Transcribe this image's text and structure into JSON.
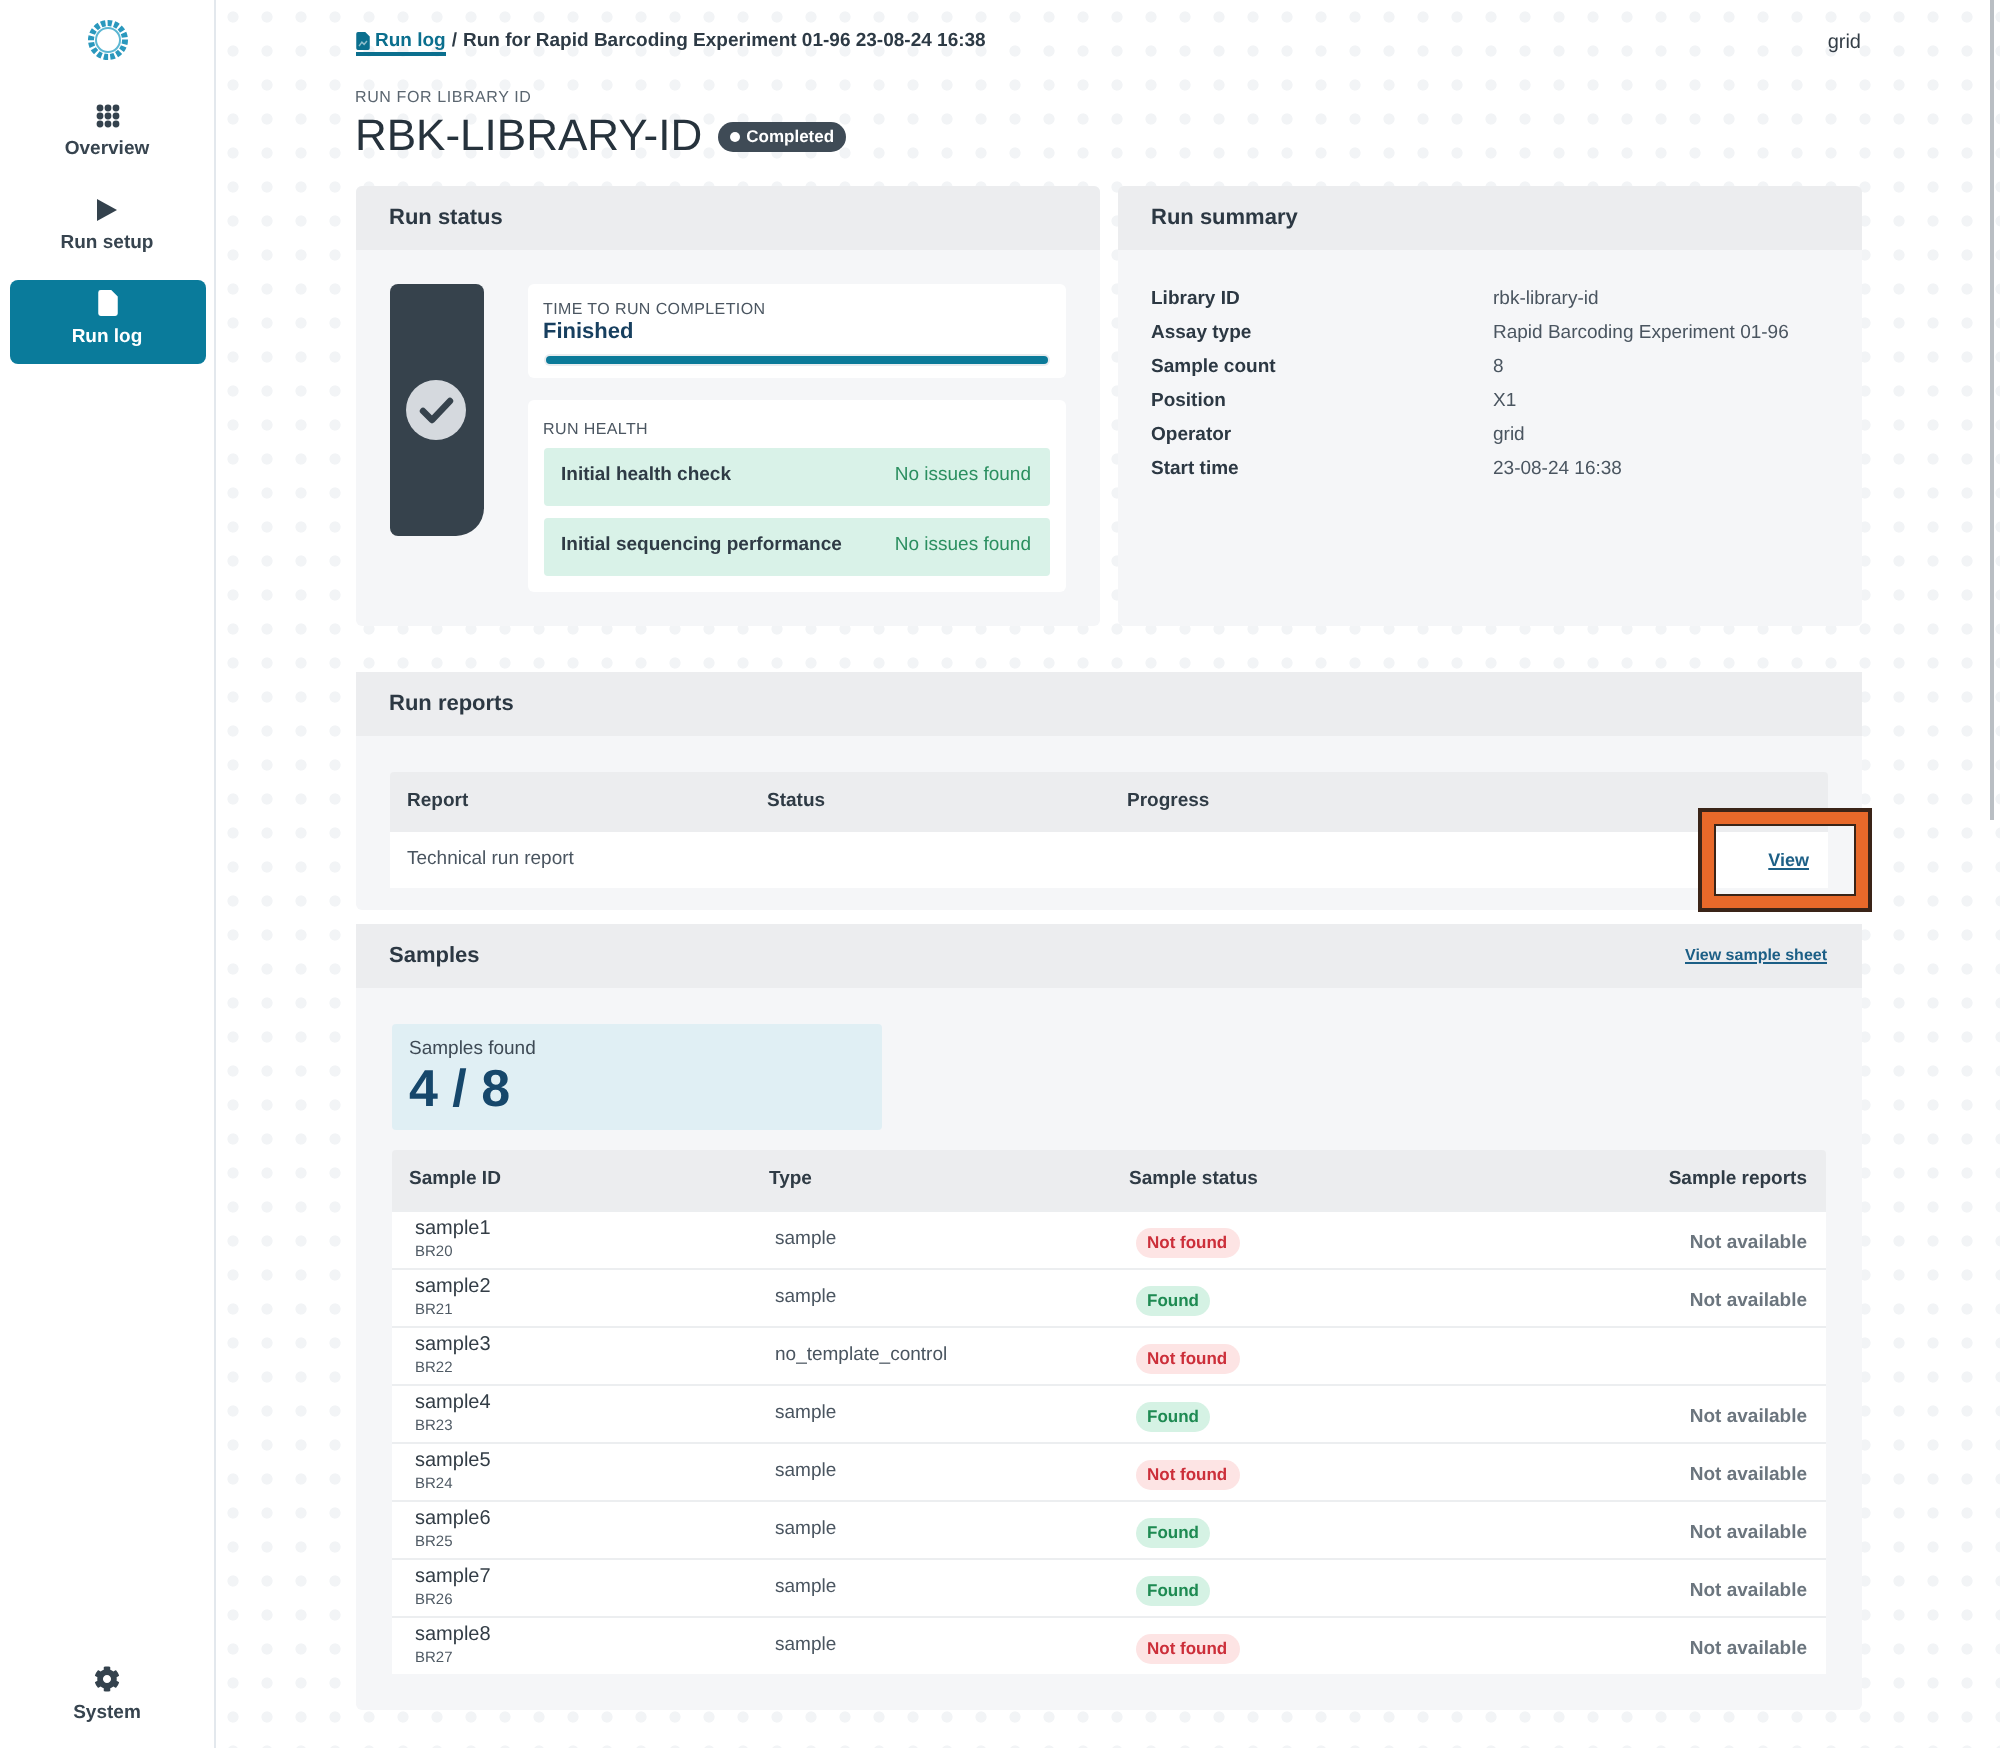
{
  "sidebar": {
    "items": [
      {
        "label": "Overview",
        "kind": "grid",
        "selected": false
      },
      {
        "label": "Run setup",
        "kind": "play",
        "selected": false
      },
      {
        "label": "Run log",
        "kind": "document",
        "selected": true
      }
    ],
    "footer_items": [
      {
        "label": "System",
        "kind": "gear",
        "selected": false
      }
    ]
  },
  "breadcrumb": {
    "link": "Run log",
    "separator": "/",
    "current": "Run for Rapid Barcoding Experiment 01-96 23-08-24 16:38"
  },
  "user": "grid",
  "header": {
    "eyebrow": "RUN FOR LIBRARY ID",
    "title": "RBK-LIBRARY-ID",
    "badge": "Completed"
  },
  "run_status": {
    "title": "Run status",
    "completion": {
      "label": "TIME TO RUN COMPLETION",
      "value": "Finished",
      "level": 1
    },
    "health": {
      "label": "RUN HEALTH",
      "checks": [
        {
          "name": "Initial health check",
          "result": "No issues found",
          "ok": true
        },
        {
          "name": "Initial sequencing performance",
          "result": "No issues found",
          "ok": true
        }
      ]
    }
  },
  "run_summary": {
    "title": "Run summary",
    "rows": [
      {
        "label": "Library ID",
        "value": "rbk-library-id"
      },
      {
        "label": "Assay type",
        "value": "Rapid Barcoding Experiment 01-96"
      },
      {
        "label": "Sample count",
        "value": "8"
      },
      {
        "label": "Position",
        "value": "X1"
      },
      {
        "label": "Operator",
        "value": "grid"
      },
      {
        "label": "Start time",
        "value": "23-08-24 16:38"
      }
    ]
  },
  "run_reports": {
    "title": "Run reports",
    "columns": [
      "Report",
      "Status",
      "Progress"
    ],
    "rows": [
      {
        "report": "Technical run report",
        "action": "View",
        "highlighted": true
      }
    ]
  },
  "samples": {
    "title": "Samples",
    "link": "View sample sheet",
    "found_label": "Samples found",
    "found_count": "4 / 8",
    "columns": [
      "Sample ID",
      "Type",
      "Sample status",
      "Sample reports"
    ],
    "rows": [
      {
        "id": "sample1",
        "barcode": "BR20",
        "type": "sample",
        "status": "Not found",
        "found": false,
        "report": "Not available"
      },
      {
        "id": "sample2",
        "barcode": "BR21",
        "type": "sample",
        "status": "Found",
        "found": true,
        "report": "Not available"
      },
      {
        "id": "sample3",
        "barcode": "BR22",
        "type": "no_template_control",
        "status": "Not found",
        "found": false
      },
      {
        "id": "sample4",
        "barcode": "BR23",
        "type": "sample",
        "status": "Found",
        "found": true,
        "report": "Not available"
      },
      {
        "id": "sample5",
        "barcode": "BR24",
        "type": "sample",
        "status": "Not found",
        "found": false,
        "report": "Not available"
      },
      {
        "id": "sample6",
        "barcode": "BR25",
        "type": "sample",
        "status": "Found",
        "found": true,
        "report": "Not available"
      },
      {
        "id": "sample7",
        "barcode": "BR26",
        "type": "sample",
        "status": "Found",
        "found": true,
        "report": "Not available"
      },
      {
        "id": "sample8",
        "barcode": "BR27",
        "type": "sample",
        "status": "Not found",
        "found": false,
        "report": "Not available"
      }
    ]
  }
}
